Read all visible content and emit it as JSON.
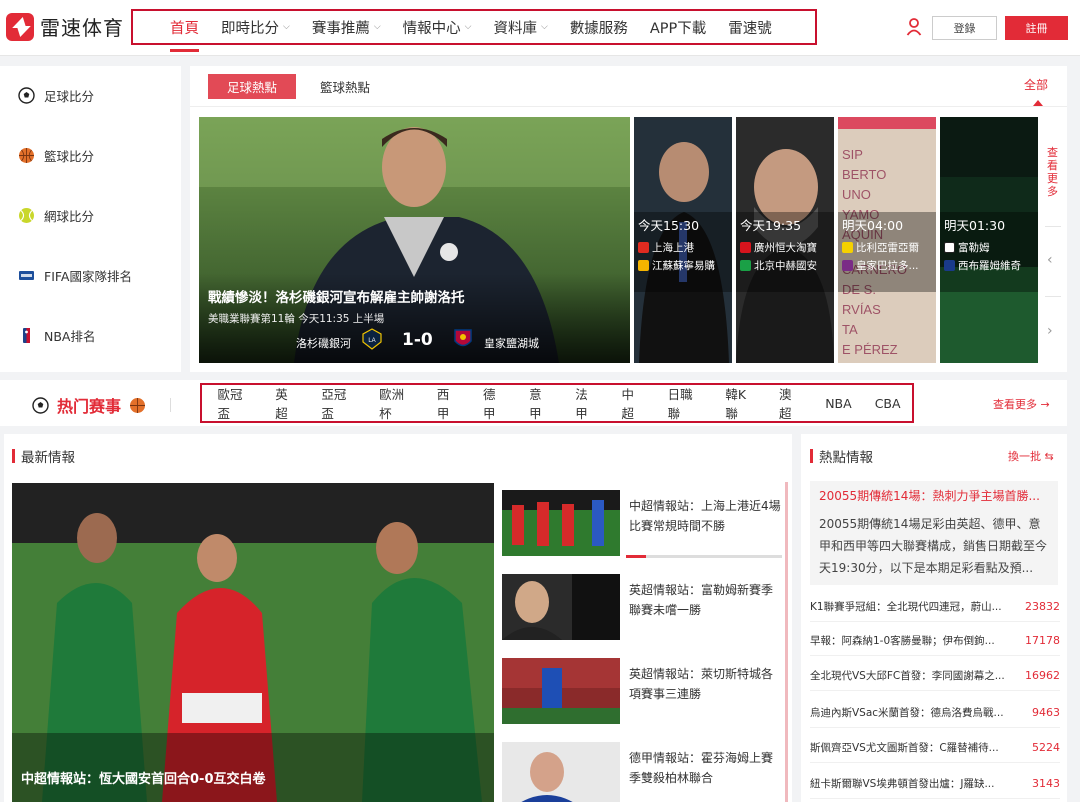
{
  "brand": {
    "name": "雷速体育",
    "color": "#e22b37"
  },
  "nav": [
    {
      "label": "首頁",
      "dropdown": false,
      "active": true
    },
    {
      "label": "即時比分",
      "dropdown": true
    },
    {
      "label": "賽事推薦",
      "dropdown": true
    },
    {
      "label": "情報中心",
      "dropdown": true
    },
    {
      "label": "資料庫",
      "dropdown": true
    },
    {
      "label": "數據服務",
      "dropdown": false
    },
    {
      "label": "APP下載",
      "dropdown": false
    },
    {
      "label": "雷速號",
      "dropdown": false
    }
  ],
  "auth": {
    "login": "登錄",
    "register": "註冊"
  },
  "sidebar": [
    {
      "label": "足球比分",
      "icon": "soccer-ball-icon"
    },
    {
      "label": "籃球比分",
      "icon": "basketball-icon"
    },
    {
      "label": "網球比分",
      "icon": "tennis-ball-icon"
    },
    {
      "label": "FIFA國家隊排名",
      "icon": "fifa-icon"
    },
    {
      "label": "NBA排名",
      "icon": "nba-icon"
    }
  ],
  "hot": {
    "tabs": [
      "足球熱點",
      "籃球熱點"
    ],
    "all": "全部",
    "see_more": "查看更多",
    "main": {
      "title": "戰績慘淡！洛杉磯銀河宣布解雇主帥謝洛托",
      "meta": "美職業聯賽第11輪  今天11:35 上半場",
      "home": "洛杉磯銀河",
      "score": "1-0",
      "away": "皇家鹽湖城"
    },
    "cards": [
      {
        "time": "今天15:30",
        "home": "上海上港",
        "away": "江蘇蘇寧易購"
      },
      {
        "time": "今天19:35",
        "home": "廣州恒大淘寶",
        "away": "北京中赫國安"
      },
      {
        "time": "明天04:00",
        "home": "比利亞雷亞爾",
        "away": "皇家巴拉多..."
      },
      {
        "time": "明天01:30",
        "home": "富勒姆",
        "away": "西布羅姆維奇"
      }
    ]
  },
  "leagues": {
    "title": "热门赛事",
    "items": [
      "歐冠盃",
      "英超",
      "亞冠盃",
      "歐洲杯",
      "西甲",
      "德甲",
      "意甲",
      "法甲",
      "中超",
      "日職聯",
      "韓K聯",
      "澳超",
      "NBA",
      "CBA"
    ],
    "more": "查看更多 →"
  },
  "latest": {
    "title": "最新情報",
    "big_caption": "中超情報站：恆大國安首回合0-0互交白卷",
    "items": [
      {
        "text": "中超情報站：上海上港近4場比賽常規時間不勝"
      },
      {
        "text": "英超情報站：富勒姆新賽季聯賽未嚐一勝"
      },
      {
        "text": "英超情報站：萊切斯特城各項賽事三連勝"
      },
      {
        "text": "德甲情報站：霍芬海姆上賽季雙殺柏林聯合"
      }
    ],
    "progress": 0.13
  },
  "hotinfo": {
    "title": "熱點情報",
    "refresh": "換一批 ⇆",
    "feature_title": "20055期傳統14場：熱刺力爭主場首勝...",
    "feature_body": "20055期傳統14場足彩由英超、德甲、意甲和西甲等四大聯賽構成，銷售日期截至今天19:30分，以下是本期足彩看點及預...",
    "rows": [
      {
        "text": "K1聯賽爭冠組：全北現代四連冠，蔚山...",
        "value": "23832"
      },
      {
        "text": "早報：阿森納1-0客勝曼聯；伊布倒鉤...",
        "value": "17178"
      },
      {
        "text": "全北現代VS大邱FC首發：李同國謝幕之...",
        "value": "16962"
      },
      {
        "text": "烏迪內斯VSac米蘭首發：德烏洛費烏戰...",
        "value": "9463"
      },
      {
        "text": "斯佩齊亞VS尤文圖斯首發：C羅替補待...",
        "value": "5224"
      },
      {
        "text": "紐卡斯爾聯VS埃弗頓首發出爐：J羅缺...",
        "value": "3143"
      }
    ]
  }
}
